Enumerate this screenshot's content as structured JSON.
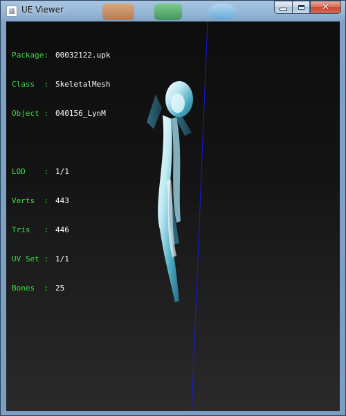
{
  "window": {
    "title": "UE Viewer"
  },
  "info_top": [
    {
      "label": "Package:",
      "value": "00032122.upk"
    },
    {
      "label": "Class  :",
      "value": "SkeletalMesh"
    },
    {
      "label": "Object :",
      "value": "040156_LynM"
    }
  ],
  "info_stats": [
    {
      "label": "LOD    :",
      "value": "1/1"
    },
    {
      "label": "Verts  :",
      "value": "443"
    },
    {
      "label": "Tris   :",
      "value": "446"
    },
    {
      "label": "UV Set :",
      "value": "1/1"
    },
    {
      "label": "Bones  :",
      "value": "25"
    }
  ],
  "colors": {
    "label": "#3ddc4a",
    "value": "#ffffff",
    "axis_line": "#1a1adf",
    "mesh": "#bfe9f2"
  },
  "icons": {
    "app": "window-icon",
    "minimize": "minimize-icon",
    "maximize": "maximize-icon",
    "close": "close-icon"
  }
}
